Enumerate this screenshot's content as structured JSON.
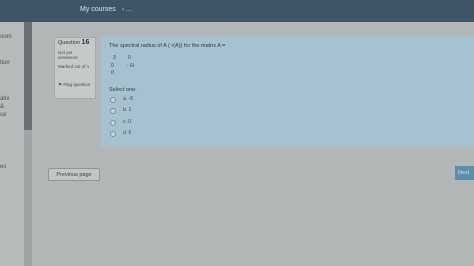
{
  "header": {
    "my_courses": "My courses",
    "breadcrumb_tail": "› ..."
  },
  "sidebar": {
    "items": [
      {
        "label": "oom"
      },
      {
        "label": "tion"
      },
      {
        "label": "atix"
      },
      {
        "label": "&"
      },
      {
        "label": "ce"
      },
      {
        "label": "es"
      }
    ]
  },
  "question_info": {
    "label": "Question",
    "number": "16",
    "status": "Not yet answered",
    "marked": "Marked out of 1",
    "flag_label": "Flag question"
  },
  "question": {
    "text": "The spectral radius of A ( r(A)) for the matrix A =",
    "matrix": [
      [
        "3",
        "0"
      ],
      [
        "0",
        "- 6i"
      ],
      [
        "0",
        ""
      ]
    ],
    "select_one": "Select one:",
    "options": [
      {
        "label": "a. -6"
      },
      {
        "label": "b. 1"
      },
      {
        "label": "c. 0"
      },
      {
        "label": "d. 6"
      }
    ]
  },
  "nav": {
    "previous": "Previous page",
    "next": "Next"
  },
  "colors": {
    "question_panel": "#a6c2d1",
    "topbar": "#3e5568",
    "next_button": "#5e8fa8"
  }
}
